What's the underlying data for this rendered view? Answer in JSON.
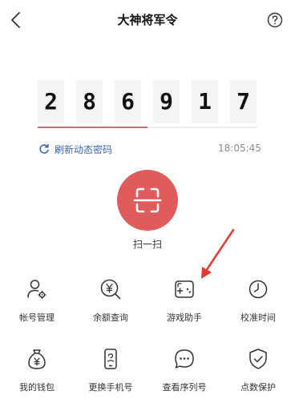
{
  "header": {
    "title": "大神将军令"
  },
  "code": {
    "digits": [
      "2",
      "8",
      "6",
      "9",
      "1",
      "7"
    ],
    "progress": 0.5,
    "progress_color": "#e8646a"
  },
  "refresh": {
    "label": "刷新动态密码"
  },
  "clock": {
    "time": "18:05:45"
  },
  "scan": {
    "label": "扫一扫",
    "color": "#e05b5b"
  },
  "grid": {
    "items": [
      {
        "label": "帐号管理",
        "icon": "account-settings-icon"
      },
      {
        "label": "余额查询",
        "icon": "yuan-search-icon"
      },
      {
        "label": "游戏助手",
        "icon": "gamepad-icon"
      },
      {
        "label": "校准时间",
        "icon": "clock-icon"
      },
      {
        "label": "我的钱包",
        "icon": "money-bag-icon"
      },
      {
        "label": "更换手机号",
        "icon": "phone-change-icon"
      },
      {
        "label": "查看序列号",
        "icon": "chat-bubble-icon"
      },
      {
        "label": "点数保护",
        "icon": "shield-check-icon"
      }
    ]
  },
  "annotation": {
    "color": "#e53935"
  }
}
